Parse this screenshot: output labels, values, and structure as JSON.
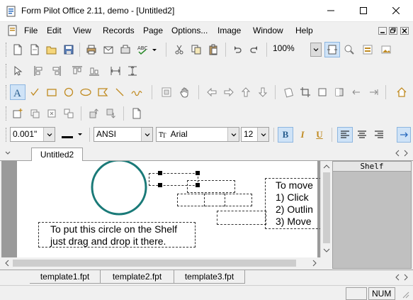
{
  "window": {
    "title": "Form Pilot Office 2.11, demo - [Untitled2]"
  },
  "menu": {
    "items": [
      "File",
      "Edit",
      "View",
      "Records",
      "Page",
      "Options...",
      "Image",
      "Window",
      "Help"
    ]
  },
  "toolbar": {
    "zoom_value": "100%",
    "line_width_value": "0.001\"",
    "charset_value": "ANSI",
    "font_value": "Arial",
    "font_size_value": "12",
    "bold_label": "B",
    "italic_label": "I",
    "underline_label": "U"
  },
  "doc_tabs": {
    "active": "Untitled2"
  },
  "page": {
    "note_shelf_line1": "To put this circle on the Shelf",
    "note_shelf_line2": "just drag and drop it there.",
    "note_move_line1": "To move",
    "note_move_line2": "1) Click",
    "note_move_line3": "2) Outlin",
    "note_move_line4": "3) Move"
  },
  "shelf": {
    "title": "Shelf"
  },
  "template_tabs": [
    "template1.fpt",
    "template2.fpt",
    "template3.fpt"
  ],
  "status": {
    "num": "NUM"
  },
  "colors": {
    "circle": "#1a7a78",
    "accent": "#cfe3f7"
  }
}
